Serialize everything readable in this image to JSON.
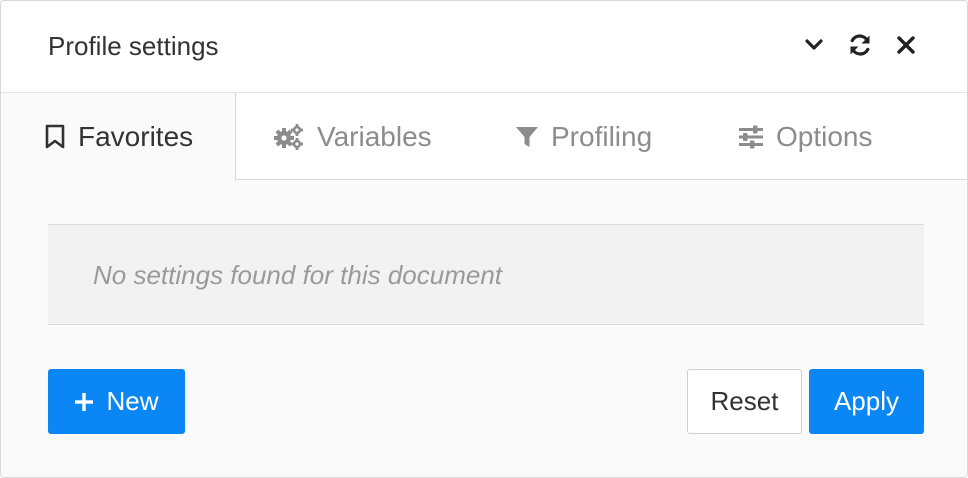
{
  "header": {
    "title": "Profile settings",
    "icons": [
      "chevron-down-icon",
      "refresh-icon",
      "close-icon"
    ]
  },
  "tabs": [
    {
      "label": "Favorites",
      "icon": "bookmark-icon",
      "active": true
    },
    {
      "label": "Variables",
      "icon": "gears-icon",
      "active": false
    },
    {
      "label": "Profiling",
      "icon": "filter-icon",
      "active": false
    },
    {
      "label": "Options",
      "icon": "sliders-icon",
      "active": false
    }
  ],
  "content": {
    "empty_message": "No settings found for this document"
  },
  "footer": {
    "new_label": "New",
    "reset_label": "Reset",
    "apply_label": "Apply"
  },
  "colors": {
    "accent": "#0b87f5",
    "text": "#333333",
    "muted": "#8c8c8c"
  }
}
